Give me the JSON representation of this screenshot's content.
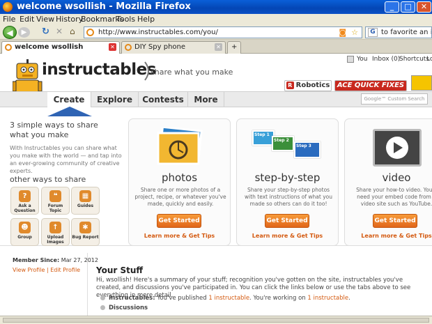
{
  "window": {
    "title": "welcome wsollish - Mozilla Firefox"
  },
  "menu": [
    "File",
    "Edit",
    "View",
    "History",
    "Bookmarks",
    "Tools",
    "Help"
  ],
  "address": {
    "url": "http://www.instructables.com/you/"
  },
  "search": {
    "value": "to favorite an instru"
  },
  "tabs": [
    {
      "label": "welcome wsollish",
      "active": true
    },
    {
      "label": "DIY Spy phone",
      "active": false
    }
  ],
  "site": {
    "logo": "instructables",
    "tagline": "share what you make",
    "toplinks": [
      "You",
      "Inbox (0)",
      "Shortcuts",
      "Lo"
    ],
    "sponsors": [
      "Robotics",
      "ACE QUICK FIXES"
    ],
    "nav": [
      "Create",
      "Explore",
      "Contests",
      "More"
    ],
    "nav_search_placeholder": "Google™ Custom Search"
  },
  "create_panel": {
    "heading": "3 simple ways to share what you make",
    "description": "With Instructables you can share what you make with the world — and tap into an ever-growing community of creative experts.",
    "other_heading": "other ways to share",
    "other_ways": [
      {
        "label": "Ask a Question",
        "icon": "question-icon"
      },
      {
        "label": "Forum Topic",
        "icon": "forum-icon"
      },
      {
        "label": "Guides",
        "icon": "guides-icon"
      },
      {
        "label": "Group",
        "icon": "group-icon"
      },
      {
        "label": "Upload Images",
        "icon": "upload-icon"
      },
      {
        "label": "Bug Report",
        "icon": "bug-icon"
      }
    ],
    "cards": [
      {
        "title": "photos",
        "desc": "Share one or more photos of a project, recipe, or whatever you've made, quickly and easily.",
        "button": "Get Started",
        "link": "Learn more & Get Tips"
      },
      {
        "title": "step-by-step",
        "desc": "Share your step-by-step photos with text instructions of what you made so others can do it too!",
        "button": "Get Started",
        "link": "Learn more & Get Tips",
        "steps": [
          "Step 1",
          "Step 2",
          "Step 3"
        ]
      },
      {
        "title": "video",
        "desc": "Share your how-to video. You'll need your embed code from a video site such as YouTube.",
        "button": "Get Started",
        "link": "Learn more & Get Tips"
      }
    ]
  },
  "profile": {
    "member_since_label": "Member Since:",
    "member_since": "Mar 27, 2012",
    "view_profile": "View Profile",
    "edit_profile": "Edit Profile"
  },
  "your_stuff": {
    "heading": "Your Stuff",
    "intro": "Hi, wsollish! Here's a summary of your stuff; recognition you've gotten on the site, instructables you've created, and discussions you've participated in. You can click the links below or use the tabs above to see everything in more detail.",
    "instructables_label": "Instructables:",
    "published_pre": "You've published",
    "published_link": "1 instructable",
    "working_pre": ". You're working on",
    "working_link": "1 instructable",
    "discussions_label": "Discussions"
  }
}
